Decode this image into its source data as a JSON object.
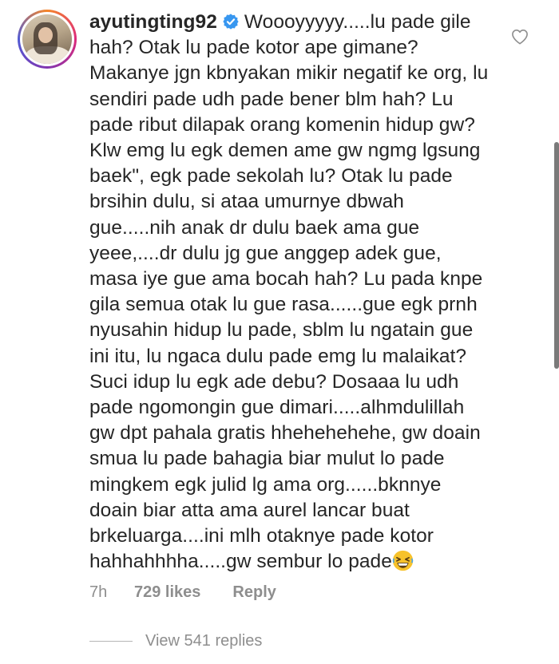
{
  "comment": {
    "username": "ayutingting92",
    "text": "Woooyyyyy.....lu pade gile hah? Otak lu pade kotor ape gimane? Makanye jgn kbnyakan mikir negatif ke org, lu sendiri pade udh pade bener blm hah? Lu pade ribut dilapak orang komenin hidup gw? Klw emg lu egk demen ame gw ngmg lgsung baek\", egk pade sekolah lu? Otak lu pade brsihin dulu, si ataa umurnye dbwah gue.....nih anak dr dulu baek ama gue yeee,....dr dulu jg gue anggep adek gue, masa iye gue ama bocah hah? Lu pada knpe gila semua otak lu gue rasa......gue egk prnh nyusahin hidup lu pade, sblm lu ngatain gue ini itu, lu ngaca dulu pade emg lu malaikat? Suci idup lu egk ade debu? Dosaaa lu udh pade ngomongin gue dimari.....alhmdulillah gw dpt pahala gratis hhehehehehe, gw doain smua lu pade bahagia biar mulut lo pade mingkem egk julid lg ama org......bknnye doain biar atta ama aurel lancar buat brkeluarga....ini mlh otaknye pade kotor hahhahhhha.....gw sembur lo pade",
    "time": "7h",
    "likes": "729 likes",
    "reply_label": "Reply",
    "view_replies": "View 541 replies"
  },
  "icons": {
    "verified": "verified-badge-icon",
    "heart": "heart-outline-icon",
    "emoji": "grinning-squinting-face-icon"
  },
  "colors": {
    "text": "#262626",
    "secondary": "#8e8e8e",
    "verified": "#3897f0"
  }
}
